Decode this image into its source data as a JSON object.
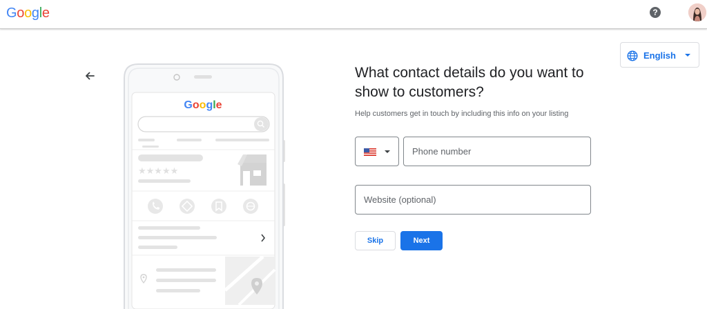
{
  "header": {
    "logo_letters": [
      "G",
      "o",
      "o",
      "g",
      "l",
      "e"
    ],
    "help_symbol": "?",
    "help_icon": "help-circle-icon",
    "avatar_icon": "profile-avatar"
  },
  "language": {
    "label": "English",
    "icon": "globe-icon"
  },
  "illustration": {
    "logo_letters": [
      "G",
      "o",
      "o",
      "g",
      "l",
      "e"
    ],
    "rating_stars": "★★★★★",
    "action_icons": [
      "phone-icon",
      "directions-icon",
      "save-icon",
      "website-icon"
    ]
  },
  "form": {
    "heading": "What contact details do you want to show to customers?",
    "subtext": "Help customers get in touch by including this info on your listing",
    "country_flag": "us-flag-icon",
    "phone_placeholder": "Phone number",
    "website_placeholder": "Website (optional)",
    "skip_label": "Skip",
    "next_label": "Next"
  },
  "colors": {
    "accent": "#1a73e8",
    "text_primary": "#202124",
    "text_secondary": "#5f6368",
    "border": "#80868b"
  }
}
